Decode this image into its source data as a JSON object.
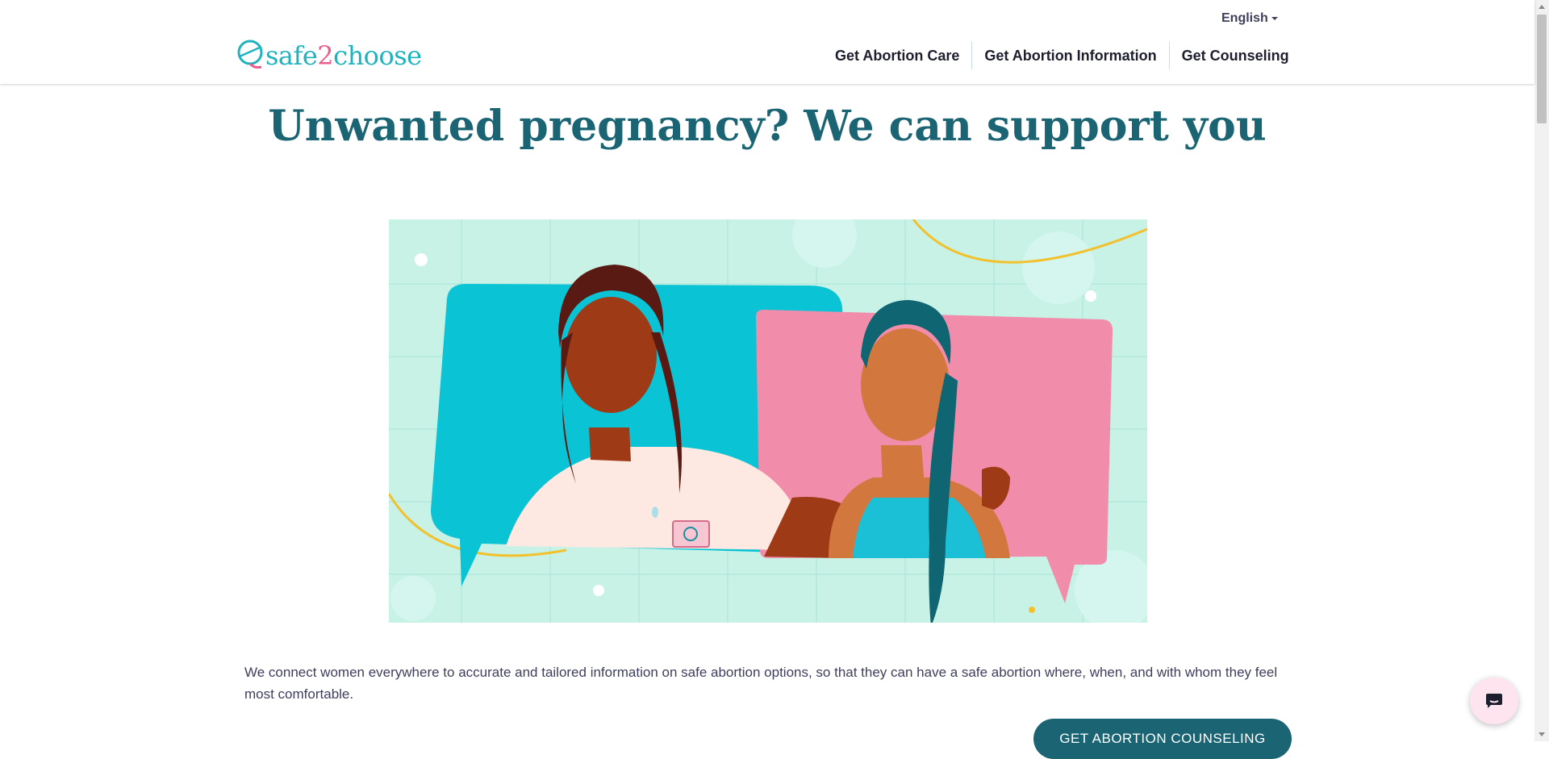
{
  "header": {
    "language": "English",
    "logo": {
      "text_before": "safe",
      "text_num": "2",
      "text_after": "choose"
    },
    "nav": [
      {
        "label": "Get Abortion Care"
      },
      {
        "label": "Get Abortion Information"
      },
      {
        "label": "Get Counseling"
      }
    ]
  },
  "main": {
    "headline": "Unwanted pregnancy? We can support you",
    "intro": "We connect women everywhere to accurate and tailored information on safe abortion options, so that they can have a safe abortion where, when, and with whom they feel most comfortable.",
    "cta_label": "GET ABORTION COUNSELING"
  },
  "icons": {
    "chat": "chat-bubble-icon",
    "language_caret": "caret-down-icon"
  },
  "colors": {
    "brand_teal": "#1a6474",
    "logo_teal": "#1fb3bf",
    "logo_pink": "#ea5d8b",
    "hero_bg": "#c8f2e6",
    "bubble_blue": "#0ac4d6",
    "bubble_pink": "#f28cab",
    "chat_bg": "#fde4ef"
  }
}
